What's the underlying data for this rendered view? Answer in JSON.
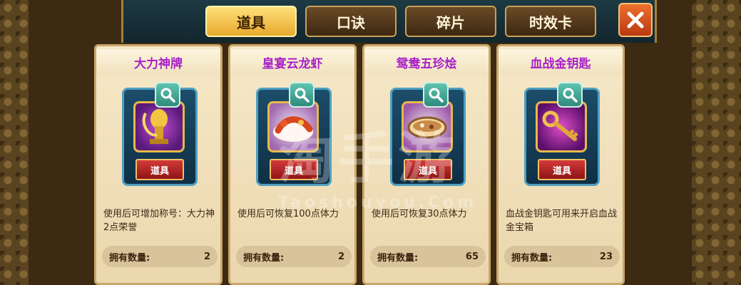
{
  "tabs": [
    {
      "label": "道具",
      "active": true
    },
    {
      "label": "口诀",
      "active": false
    },
    {
      "label": "碎片",
      "active": false
    },
    {
      "label": "时效卡",
      "active": false
    }
  ],
  "close_icon": "close-x-icon",
  "owned_label": "拥有数量:",
  "badge_label": "道具",
  "items": [
    {
      "name": "大力神牌",
      "description": "使用后可增加称号：大力神2点荣誉",
      "count": "2",
      "icon": "golden-trophy-icon"
    },
    {
      "name": "皇宴云龙虾",
      "description": "使用后可恢复100点体力",
      "count": "2",
      "icon": "lobster-dish-icon"
    },
    {
      "name": "鸳鸯五珍烩",
      "description": "使用后可恢复30点体力",
      "count": "65",
      "icon": "soup-bowl-icon"
    },
    {
      "name": "血战金钥匙",
      "description": "血战金钥匙可用来开启血战金宝箱",
      "count": "23",
      "icon": "golden-key-icon"
    }
  ],
  "watermark": {
    "text": "淘手游",
    "sub": "Taoshouyou.Com"
  },
  "colors": {
    "title": "#a820c8",
    "active_tab": "#f5c04a",
    "badge": "#b32020"
  }
}
